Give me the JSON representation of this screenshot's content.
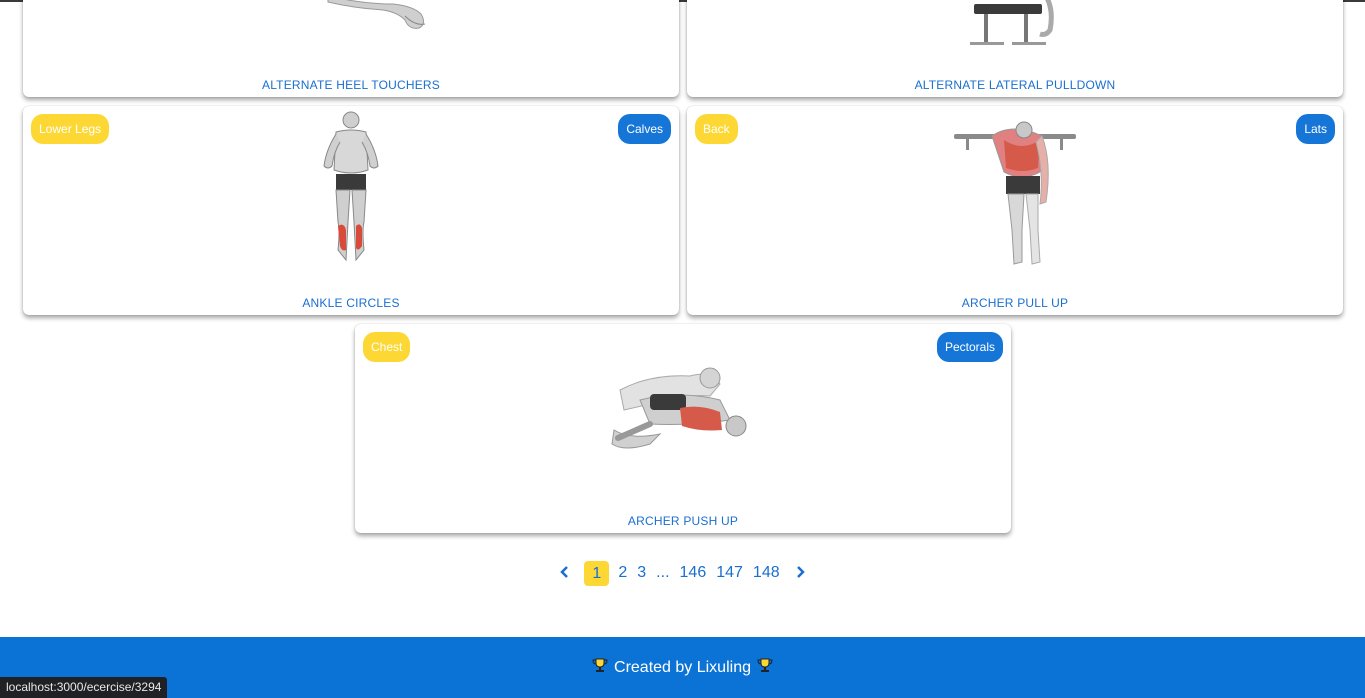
{
  "cards": [
    {
      "title": "ALTERNATE HEEL TOUCHERS",
      "body_part": "",
      "target": ""
    },
    {
      "title": "ALTERNATE LATERAL PULLDOWN",
      "body_part": "",
      "target": ""
    },
    {
      "title": "ANKLE CIRCLES",
      "body_part": "Lower Legs",
      "target": "Calves"
    },
    {
      "title": "ARCHER PULL UP",
      "body_part": "Back",
      "target": "Lats"
    },
    {
      "title": "ARCHER PUSH UP",
      "body_part": "Chest",
      "target": "Pectorals"
    }
  ],
  "pagination": {
    "prev_icon": "chevron-left-icon",
    "next_icon": "chevron-right-icon",
    "pages": [
      "1",
      "2",
      "3",
      "...",
      "146",
      "147",
      "148"
    ],
    "active": "1"
  },
  "footer": {
    "text": "Created by Lixuling",
    "icon": "trophy-icon"
  },
  "status_bar": {
    "url": "localhost:3000/ecercise/3294"
  },
  "colors": {
    "accent_blue": "#1676d8",
    "badge_yellow": "#fdd835",
    "footer_blue": "#0c73d6",
    "title_blue": "#1a6fd0"
  }
}
